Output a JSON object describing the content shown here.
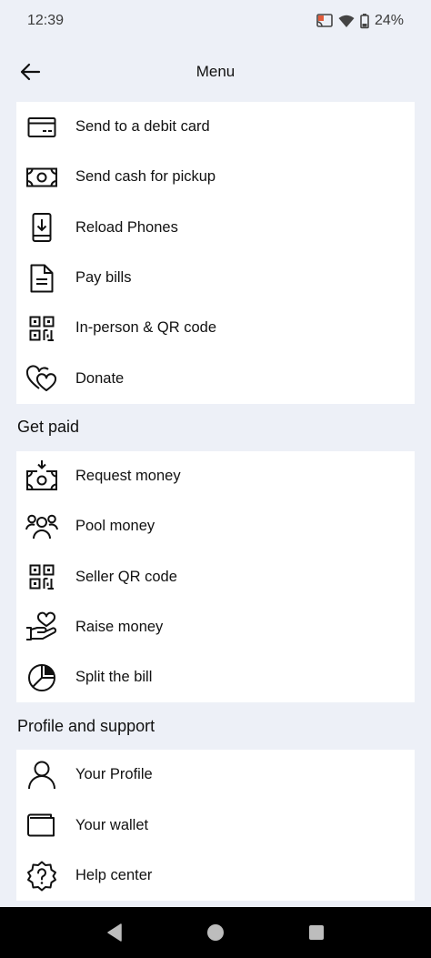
{
  "status": {
    "time": "12:39",
    "battery": "24%"
  },
  "header": {
    "title": "Menu"
  },
  "send_section": {
    "items": [
      {
        "label": "Send to a debit card",
        "icon": "debit-card-icon"
      },
      {
        "label": "Send cash for pickup",
        "icon": "cash-icon"
      },
      {
        "label": "Reload Phones",
        "icon": "phone-reload-icon"
      },
      {
        "label": "Pay bills",
        "icon": "bill-document-icon"
      },
      {
        "label": "In-person & QR code",
        "icon": "qr-code-icon"
      },
      {
        "label": "Donate",
        "icon": "hearts-icon"
      }
    ]
  },
  "get_paid": {
    "title": "Get paid",
    "items": [
      {
        "label": "Request money",
        "icon": "request-cash-icon"
      },
      {
        "label": "Pool money",
        "icon": "group-people-icon"
      },
      {
        "label": "Seller QR code",
        "icon": "qr-code-icon"
      },
      {
        "label": "Raise money",
        "icon": "hand-heart-icon"
      },
      {
        "label": "Split the bill",
        "icon": "pie-chart-icon"
      }
    ]
  },
  "profile_support": {
    "title": "Profile and support",
    "items": [
      {
        "label": "Your Profile",
        "icon": "person-icon"
      },
      {
        "label": "Your wallet",
        "icon": "wallet-icon"
      },
      {
        "label": "Help center",
        "icon": "help-badge-icon"
      }
    ]
  },
  "colors": {
    "background": "#edf0f7",
    "card": "#ffffff",
    "text": "#111111",
    "nav": "#000000"
  }
}
